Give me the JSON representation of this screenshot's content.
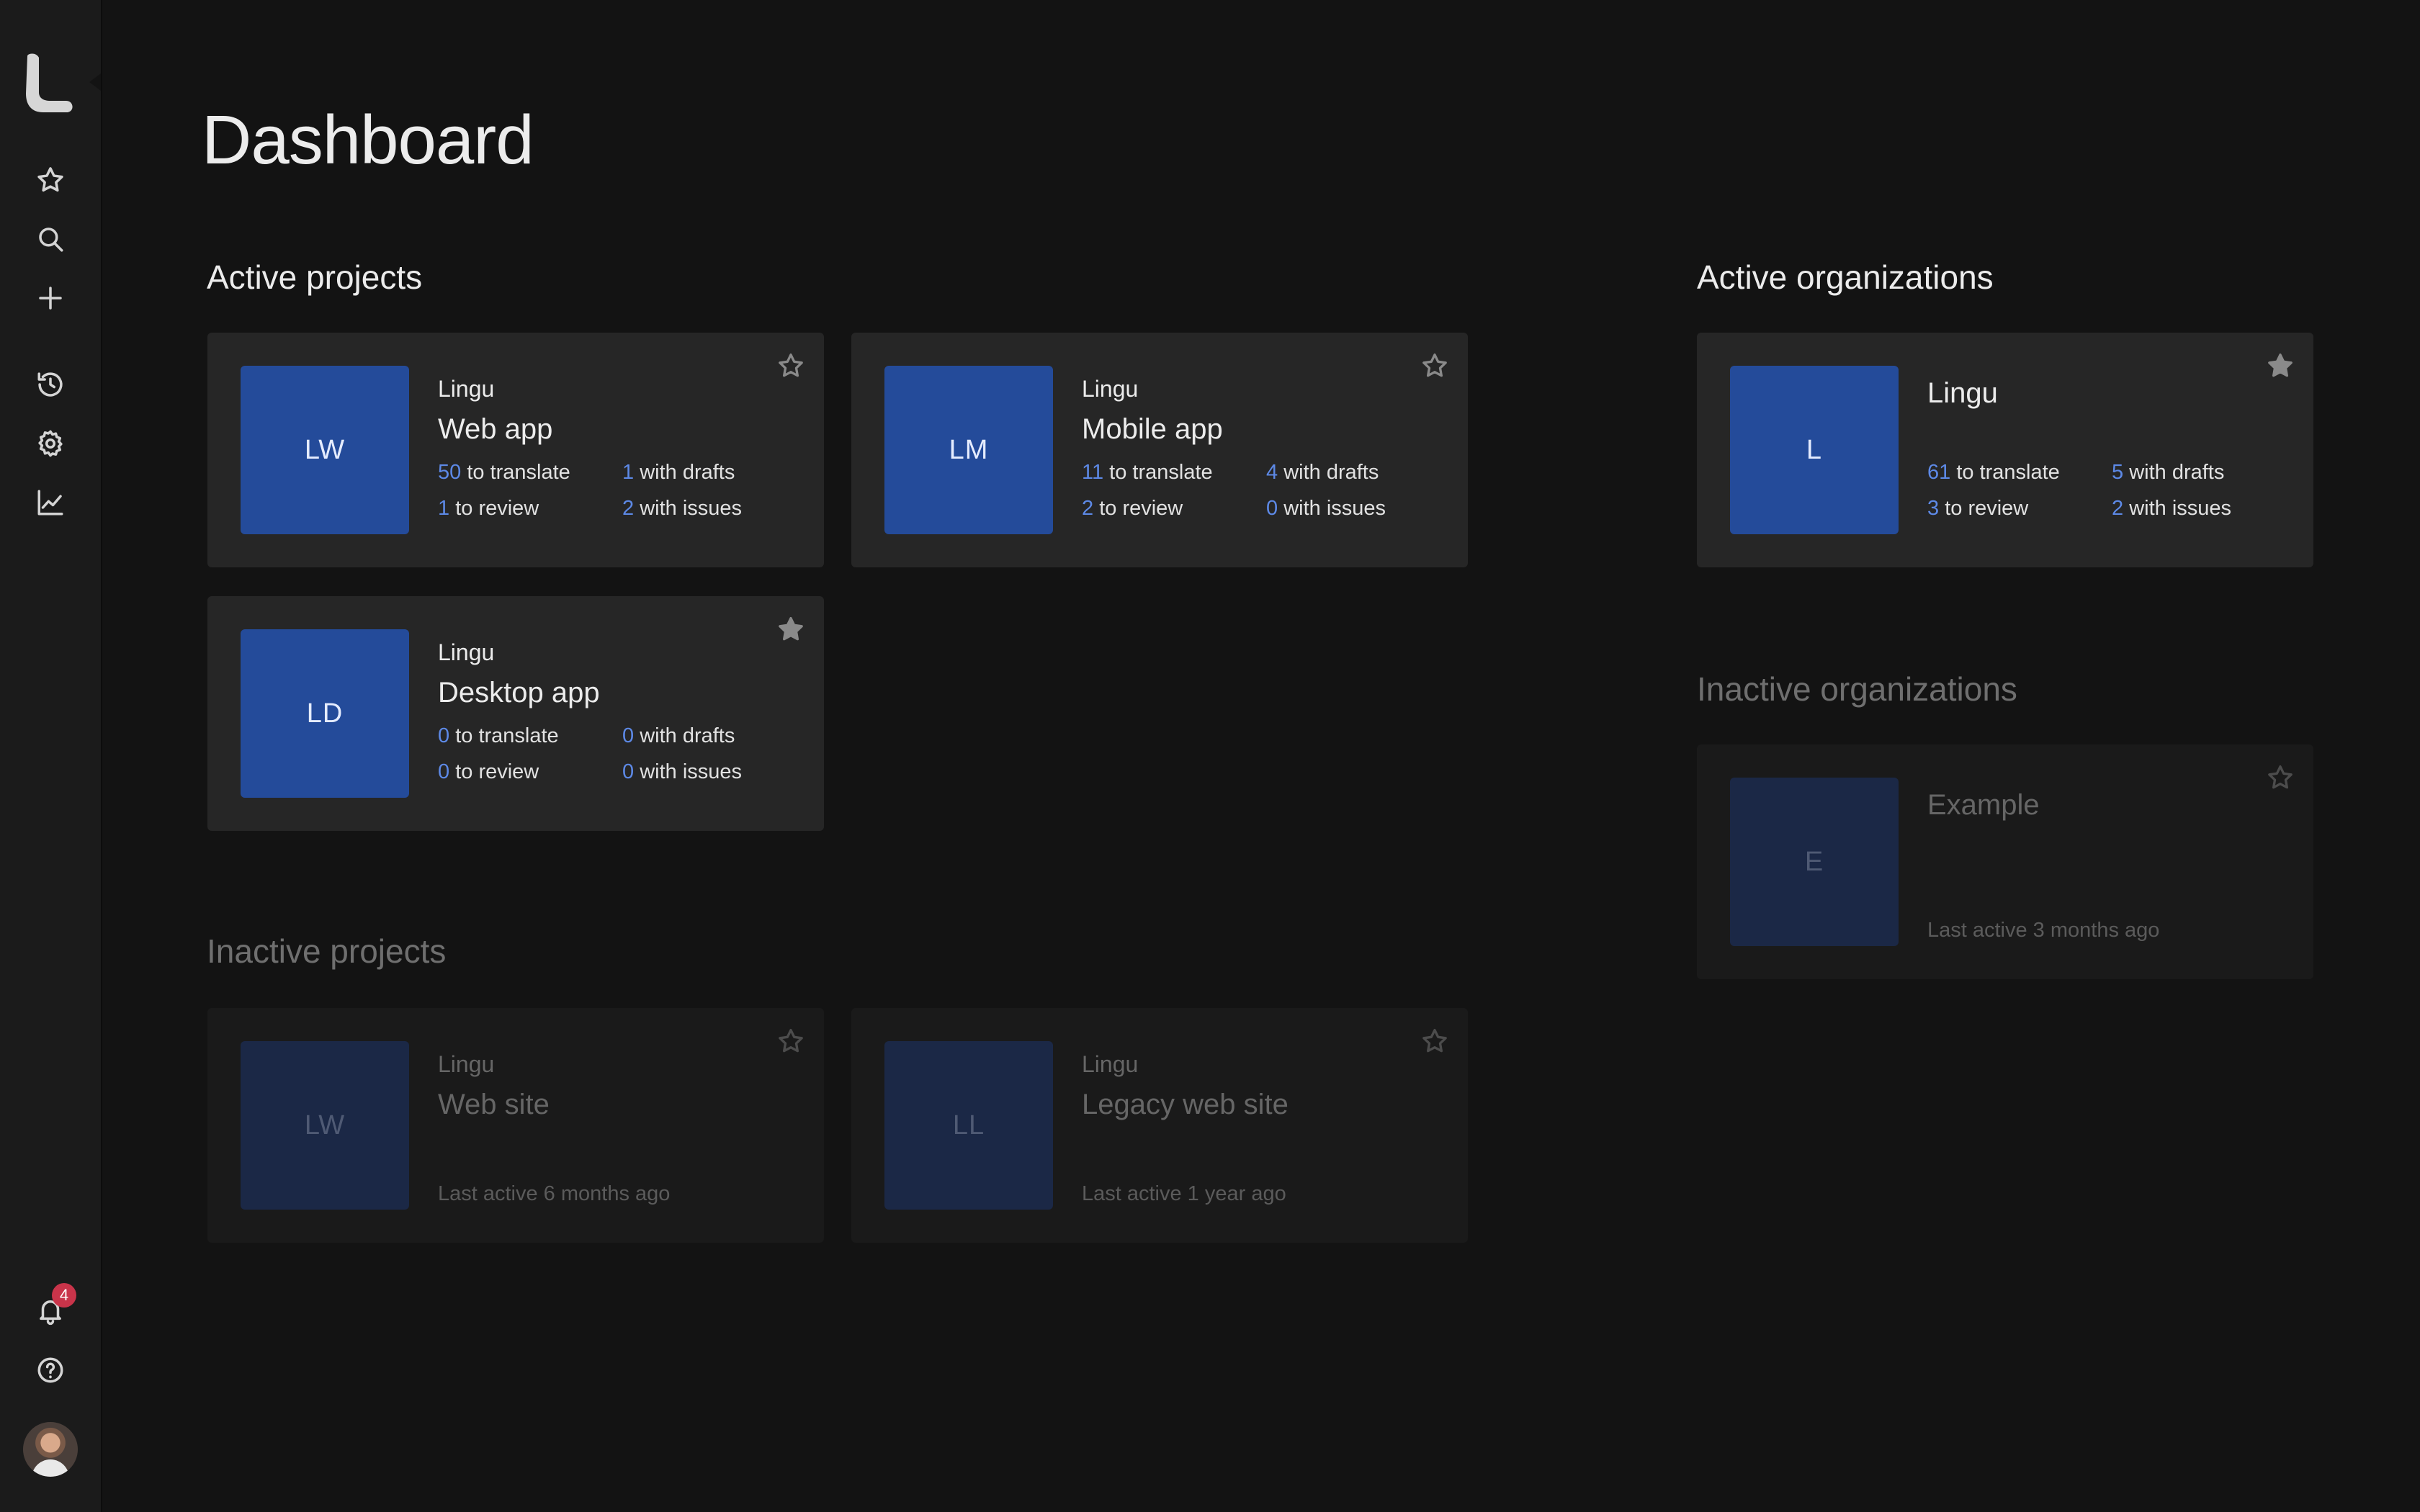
{
  "page": {
    "title": "Dashboard"
  },
  "sidebar": {
    "items": [
      {
        "icon": "star-icon",
        "label": "Favorites"
      },
      {
        "icon": "search-icon",
        "label": "Search"
      },
      {
        "icon": "plus-icon",
        "label": "Create"
      },
      {
        "icon": "history-icon",
        "label": "Recent"
      },
      {
        "icon": "gear-icon",
        "label": "Settings"
      },
      {
        "icon": "chart-icon",
        "label": "Statistics"
      }
    ],
    "notifications_count": "4"
  },
  "sections": {
    "active_projects": "Active projects",
    "inactive_projects": "Inactive projects",
    "active_orgs": "Active organizations",
    "inactive_orgs": "Inactive organizations"
  },
  "active_projects": [
    {
      "initials": "LW",
      "org": "Lingu",
      "name": "Web app",
      "starred": false,
      "to_translate": "50",
      "to_translate_label": "to translate",
      "with_drafts": "1",
      "with_drafts_label": "with drafts",
      "to_review": "1",
      "to_review_label": "to review",
      "with_issues": "2",
      "with_issues_label": "with issues"
    },
    {
      "initials": "LM",
      "org": "Lingu",
      "name": "Mobile app",
      "starred": false,
      "to_translate": "11",
      "to_translate_label": "to translate",
      "with_drafts": "4",
      "with_drafts_label": "with drafts",
      "to_review": "2",
      "to_review_label": "to review",
      "with_issues": "0",
      "with_issues_label": "with issues"
    },
    {
      "initials": "LD",
      "org": "Lingu",
      "name": "Desktop app",
      "starred": true,
      "to_translate": "0",
      "to_translate_label": "to translate",
      "with_drafts": "0",
      "with_drafts_label": "with drafts",
      "to_review": "0",
      "to_review_label": "to review",
      "with_issues": "0",
      "with_issues_label": "with issues"
    }
  ],
  "inactive_projects": [
    {
      "initials": "LW",
      "org": "Lingu",
      "name": "Web site",
      "last_active": "Last active 6 months ago"
    },
    {
      "initials": "LL",
      "org": "Lingu",
      "name": "Legacy web site",
      "last_active": "Last active 1 year ago"
    }
  ],
  "active_orgs": [
    {
      "initials": "L",
      "name": "Lingu",
      "starred": true,
      "to_translate": "61",
      "to_translate_label": "to translate",
      "with_drafts": "5",
      "with_drafts_label": "with drafts",
      "to_review": "3",
      "to_review_label": "to review",
      "with_issues": "2",
      "with_issues_label": "with issues"
    }
  ],
  "inactive_orgs": [
    {
      "initials": "E",
      "name": "Example",
      "last_active": "Last active 3 months ago"
    }
  ],
  "colors": {
    "accent": "#5d89e6",
    "tile": "#244b9a",
    "badge": "#c9344a"
  }
}
